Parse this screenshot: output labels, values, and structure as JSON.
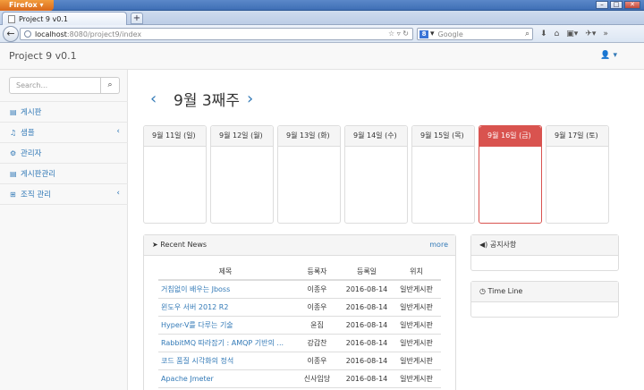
{
  "browser": {
    "app_button": "Firefox",
    "tab_title": "Project 9 v0.1",
    "url_host": "localhost",
    "url_rest": ":8080/project9/index",
    "search_engine_placeholder": "Google"
  },
  "header": {
    "brand": "Project 9 v0.1",
    "user_icon": "user-icon"
  },
  "sidebar": {
    "search_placeholder": "Search...",
    "items": [
      {
        "label": "게시판",
        "icon": "board-icon",
        "has_submenu": false
      },
      {
        "label": "샘플",
        "icon": "music-icon",
        "has_submenu": true
      },
      {
        "label": "관리자",
        "icon": "gear-icon",
        "has_submenu": false
      },
      {
        "label": "게시판관리",
        "icon": "board-icon",
        "has_submenu": false
      },
      {
        "label": "조직 관리",
        "icon": "sitemap-icon",
        "has_submenu": true
      }
    ]
  },
  "calendar": {
    "week_title": "9월 3째주",
    "days": [
      {
        "label": "9월 11일 (일)",
        "active": false
      },
      {
        "label": "9월 12일 (월)",
        "active": false
      },
      {
        "label": "9월 13일 (화)",
        "active": false
      },
      {
        "label": "9월 14일 (수)",
        "active": false
      },
      {
        "label": "9월 15일 (목)",
        "active": false
      },
      {
        "label": "9월 16일 (금)",
        "active": true
      },
      {
        "label": "9월 17일 (토)",
        "active": false
      }
    ],
    "active_color": "#d9534f"
  },
  "recent_news": {
    "title": "Recent News",
    "more": "more",
    "columns": [
      "제목",
      "등록자",
      "등록일",
      "위치"
    ],
    "rows": [
      [
        "거침없이 배우는 Jboss",
        "이종우",
        "2016-08-14",
        "일반게시판"
      ],
      [
        "윈도우 서버 2012 R2",
        "이종우",
        "2016-08-14",
        "일반게시판"
      ],
      [
        "Hyper-V를 다루는 기술",
        "윤집",
        "2016-08-14",
        "일반게시판"
      ],
      [
        "RabbitMQ 따라잡기 : AMQP 기반의 ...",
        "강갑찬",
        "2016-08-14",
        "일반게시판"
      ],
      [
        "코드 품질 시각화의 정석",
        "이종우",
        "2016-08-14",
        "일반게시판"
      ],
      [
        "Apache Jmeter",
        "신사임당",
        "2016-08-14",
        "일반게시판"
      ]
    ]
  },
  "notice": {
    "title": "공지사항"
  },
  "timeline": {
    "title": "Time Line"
  },
  "colors": {
    "link": "#337ab7",
    "danger": "#d9534f"
  }
}
